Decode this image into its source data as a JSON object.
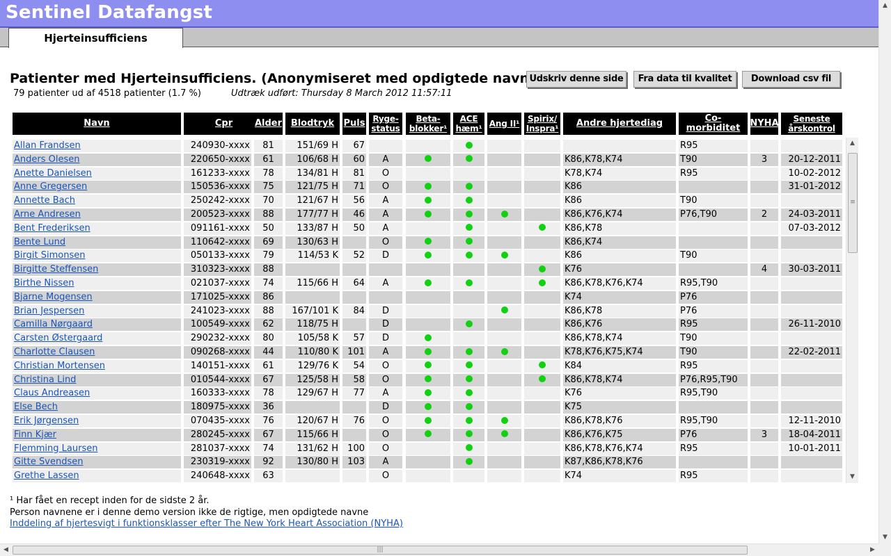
{
  "app": {
    "title": "Sentinel Datafangst"
  },
  "tabs": [
    {
      "label": "Hjerteinsufficiens"
    }
  ],
  "page": {
    "heading": "Patienter med Hjerteinsufficiens. (Anonymiseret med opdigtede navne)",
    "summary": "79 patienter ud af 4518 patienter (1.7 %)",
    "extract": "Udtræk udført: Thursday 8 March 2012 11:57:11"
  },
  "buttons": {
    "print": "Udskriv denne side",
    "quality": "Fra data til kvalitet",
    "csv": "Download csv fil"
  },
  "columns": {
    "navn": "Navn",
    "cpr": "Cpr",
    "alder": "Alder",
    "blodtryk": "Blodtryk",
    "puls": "Puls",
    "ryge_1": "Ryge-",
    "ryge_2": "status",
    "beta_1": "Beta-",
    "beta_2": "blokker¹",
    "ace_1": "ACE",
    "ace_2": "hæm¹",
    "ang": "Ang II¹",
    "spirix_1": "Spirix/",
    "spirix_2": "Inspra¹",
    "hjertediag": "Andre hjertediag",
    "comorbiditet": "Co-morbiditet",
    "nyha": "NYHA",
    "seneste_1": "Seneste",
    "seneste_2": "årskontrol"
  },
  "patients": [
    {
      "navn": "Allan Frandsen",
      "cpr": "240930-xxxx",
      "alder": "81",
      "blodtryk": "151/69 H",
      "puls": "67",
      "ryge": "",
      "beta": false,
      "ace": true,
      "ang": false,
      "spirix": false,
      "hjertediag": "",
      "comorb": "R95",
      "nyha": "",
      "seneste": ""
    },
    {
      "navn": "Anders Olesen",
      "cpr": "220650-xxxx",
      "alder": "61",
      "blodtryk": "106/68 H",
      "puls": "60",
      "ryge": "A",
      "beta": true,
      "ace": true,
      "ang": false,
      "spirix": false,
      "hjertediag": "K86,K78,K74",
      "comorb": "T90",
      "nyha": "3",
      "seneste": "20-12-2011"
    },
    {
      "navn": "Anette Danielsen",
      "cpr": "161233-xxxx",
      "alder": "78",
      "blodtryk": "134/81 H",
      "puls": "81",
      "ryge": "O",
      "beta": false,
      "ace": false,
      "ang": false,
      "spirix": false,
      "hjertediag": "K78,K74",
      "comorb": "R95",
      "nyha": "",
      "seneste": "10-02-2012"
    },
    {
      "navn": "Anne Gregersen",
      "cpr": "150536-xxxx",
      "alder": "75",
      "blodtryk": "121/75 H",
      "puls": "71",
      "ryge": "O",
      "beta": true,
      "ace": true,
      "ang": false,
      "spirix": false,
      "hjertediag": "K86",
      "comorb": "",
      "nyha": "",
      "seneste": "31-01-2012"
    },
    {
      "navn": "Annette Bach",
      "cpr": "250242-xxxx",
      "alder": "70",
      "blodtryk": "121/67 H",
      "puls": "56",
      "ryge": "A",
      "beta": true,
      "ace": true,
      "ang": false,
      "spirix": false,
      "hjertediag": "K86",
      "comorb": "T90",
      "nyha": "",
      "seneste": ""
    },
    {
      "navn": "Arne Andresen",
      "cpr": "200523-xxxx",
      "alder": "88",
      "blodtryk": "177/77 H",
      "puls": "46",
      "ryge": "A",
      "beta": true,
      "ace": true,
      "ang": true,
      "spirix": false,
      "hjertediag": "K86,K76,K74",
      "comorb": "P76,T90",
      "nyha": "2",
      "seneste": "24-03-2011"
    },
    {
      "navn": "Bent Frederiksen",
      "cpr": "091161-xxxx",
      "alder": "50",
      "blodtryk": "133/87 H",
      "puls": "50",
      "ryge": "A",
      "beta": false,
      "ace": true,
      "ang": false,
      "spirix": true,
      "hjertediag": "K86,K78",
      "comorb": "",
      "nyha": "",
      "seneste": "07-03-2012"
    },
    {
      "navn": "Bente Lund",
      "cpr": "110642-xxxx",
      "alder": "69",
      "blodtryk": "130/63 H",
      "puls": "",
      "ryge": "O",
      "beta": true,
      "ace": true,
      "ang": false,
      "spirix": false,
      "hjertediag": "K86,K74",
      "comorb": "",
      "nyha": "",
      "seneste": ""
    },
    {
      "navn": "Birgit Simonsen",
      "cpr": "050133-xxxx",
      "alder": "79",
      "blodtryk": "114/53 K",
      "puls": "52",
      "ryge": "D",
      "beta": true,
      "ace": true,
      "ang": true,
      "spirix": false,
      "hjertediag": "K86",
      "comorb": "T90",
      "nyha": "",
      "seneste": ""
    },
    {
      "navn": "Birgitte Steffensen",
      "cpr": "310323-xxxx",
      "alder": "88",
      "blodtryk": "",
      "puls": "",
      "ryge": "",
      "beta": false,
      "ace": false,
      "ang": false,
      "spirix": true,
      "hjertediag": "K76",
      "comorb": "",
      "nyha": "4",
      "seneste": "30-03-2011"
    },
    {
      "navn": "Birthe Nissen",
      "cpr": "021037-xxxx",
      "alder": "74",
      "blodtryk": "115/66 H",
      "puls": "64",
      "ryge": "A",
      "beta": true,
      "ace": true,
      "ang": false,
      "spirix": true,
      "hjertediag": "K86,K78,K76,K74",
      "comorb": "R95,T90",
      "nyha": "",
      "seneste": ""
    },
    {
      "navn": "Bjarne Mogensen",
      "cpr": "171025-xxxx",
      "alder": "86",
      "blodtryk": "",
      "puls": "",
      "ryge": "",
      "beta": false,
      "ace": false,
      "ang": false,
      "spirix": false,
      "hjertediag": "K74",
      "comorb": "P76",
      "nyha": "",
      "seneste": ""
    },
    {
      "navn": "Brian Jespersen",
      "cpr": "241023-xxxx",
      "alder": "88",
      "blodtryk": "167/101 K",
      "puls": "84",
      "ryge": "D",
      "beta": false,
      "ace": false,
      "ang": true,
      "spirix": false,
      "hjertediag": "K86,K78",
      "comorb": "P76",
      "nyha": "",
      "seneste": ""
    },
    {
      "navn": "Camilla Nørgaard",
      "cpr": "100549-xxxx",
      "alder": "62",
      "blodtryk": "118/75 H",
      "puls": "",
      "ryge": "D",
      "beta": false,
      "ace": true,
      "ang": false,
      "spirix": false,
      "hjertediag": "K86,K76",
      "comorb": "R95",
      "nyha": "",
      "seneste": "26-11-2010"
    },
    {
      "navn": "Carsten Østergaard",
      "cpr": "290232-xxxx",
      "alder": "80",
      "blodtryk": "105/58 K",
      "puls": "57",
      "ryge": "D",
      "beta": true,
      "ace": false,
      "ang": false,
      "spirix": false,
      "hjertediag": "K86,K78,K74",
      "comorb": "T90",
      "nyha": "",
      "seneste": ""
    },
    {
      "navn": "Charlotte Clausen",
      "cpr": "090268-xxxx",
      "alder": "44",
      "blodtryk": "110/80 K",
      "puls": "101",
      "ryge": "A",
      "beta": true,
      "ace": true,
      "ang": true,
      "spirix": false,
      "hjertediag": "K78,K76,K75,K74",
      "comorb": "T90",
      "nyha": "",
      "seneste": "22-02-2011"
    },
    {
      "navn": "Christian Mortensen",
      "cpr": "140151-xxxx",
      "alder": "61",
      "blodtryk": "129/76 K",
      "puls": "54",
      "ryge": "O",
      "beta": true,
      "ace": true,
      "ang": false,
      "spirix": true,
      "hjertediag": "K84",
      "comorb": "R95",
      "nyha": "",
      "seneste": ""
    },
    {
      "navn": "Christina Lind",
      "cpr": "010544-xxxx",
      "alder": "67",
      "blodtryk": "125/58 H",
      "puls": "58",
      "ryge": "O",
      "beta": true,
      "ace": true,
      "ang": false,
      "spirix": true,
      "hjertediag": "K86,K78,K74",
      "comorb": "P76,R95,T90",
      "nyha": "",
      "seneste": ""
    },
    {
      "navn": "Claus Andreasen",
      "cpr": "160333-xxxx",
      "alder": "78",
      "blodtryk": "129/67 H",
      "puls": "77",
      "ryge": "A",
      "beta": true,
      "ace": true,
      "ang": false,
      "spirix": false,
      "hjertediag": "K76",
      "comorb": "R95,T90",
      "nyha": "",
      "seneste": ""
    },
    {
      "navn": "Else Bech",
      "cpr": "180975-xxxx",
      "alder": "36",
      "blodtryk": "",
      "puls": "",
      "ryge": "D",
      "beta": true,
      "ace": true,
      "ang": false,
      "spirix": false,
      "hjertediag": "K75",
      "comorb": "",
      "nyha": "",
      "seneste": ""
    },
    {
      "navn": "Erik Jørgensen",
      "cpr": "070435-xxxx",
      "alder": "76",
      "blodtryk": "120/67 H",
      "puls": "76",
      "ryge": "O",
      "beta": true,
      "ace": true,
      "ang": true,
      "spirix": false,
      "hjertediag": "K86,K78,K76",
      "comorb": "R95,T90",
      "nyha": "",
      "seneste": "12-11-2010"
    },
    {
      "navn": "Finn Kjær",
      "cpr": "280245-xxxx",
      "alder": "67",
      "blodtryk": "115/66 H",
      "puls": "",
      "ryge": "O",
      "beta": true,
      "ace": true,
      "ang": true,
      "spirix": false,
      "hjertediag": "K86,K76,K75",
      "comorb": "P76",
      "nyha": "3",
      "seneste": "18-04-2011"
    },
    {
      "navn": "Flemming Laursen",
      "cpr": "281037-xxxx",
      "alder": "74",
      "blodtryk": "131/62 H",
      "puls": "100",
      "ryge": "O",
      "beta": false,
      "ace": true,
      "ang": false,
      "spirix": false,
      "hjertediag": "K86,K78,K76,K74",
      "comorb": "R95",
      "nyha": "",
      "seneste": "10-01-2011"
    },
    {
      "navn": "Gitte Svendsen",
      "cpr": "230319-xxxx",
      "alder": "92",
      "blodtryk": "130/80 H",
      "puls": "103",
      "ryge": "A",
      "beta": false,
      "ace": true,
      "ang": false,
      "spirix": false,
      "hjertediag": "K87,K86,K78,K76",
      "comorb": "",
      "nyha": "",
      "seneste": ""
    },
    {
      "navn": "Grethe Lassen",
      "cpr": "240648-xxxx",
      "alder": "63",
      "blodtryk": "",
      "puls": "",
      "ryge": "O",
      "beta": false,
      "ace": false,
      "ang": false,
      "spirix": false,
      "hjertediag": "K74",
      "comorb": "R95",
      "nyha": "",
      "seneste": ""
    }
  ],
  "footnotes": {
    "recept": "¹ Har fået en recept inden for de sidste 2 år.",
    "names": "Person navnene er i denne demo version ikke de rigtige, men opdigtede navne",
    "nyha_link": "Inddeling af hjertesvigt i funktionsklasser efter The New York Heart Association (NYHA)"
  },
  "colors": {
    "header": "#8e8ef0",
    "dot": "#12d012",
    "link": "#1a56b8",
    "row_light": "#efefef",
    "row_dark": "#d3d3d3"
  }
}
